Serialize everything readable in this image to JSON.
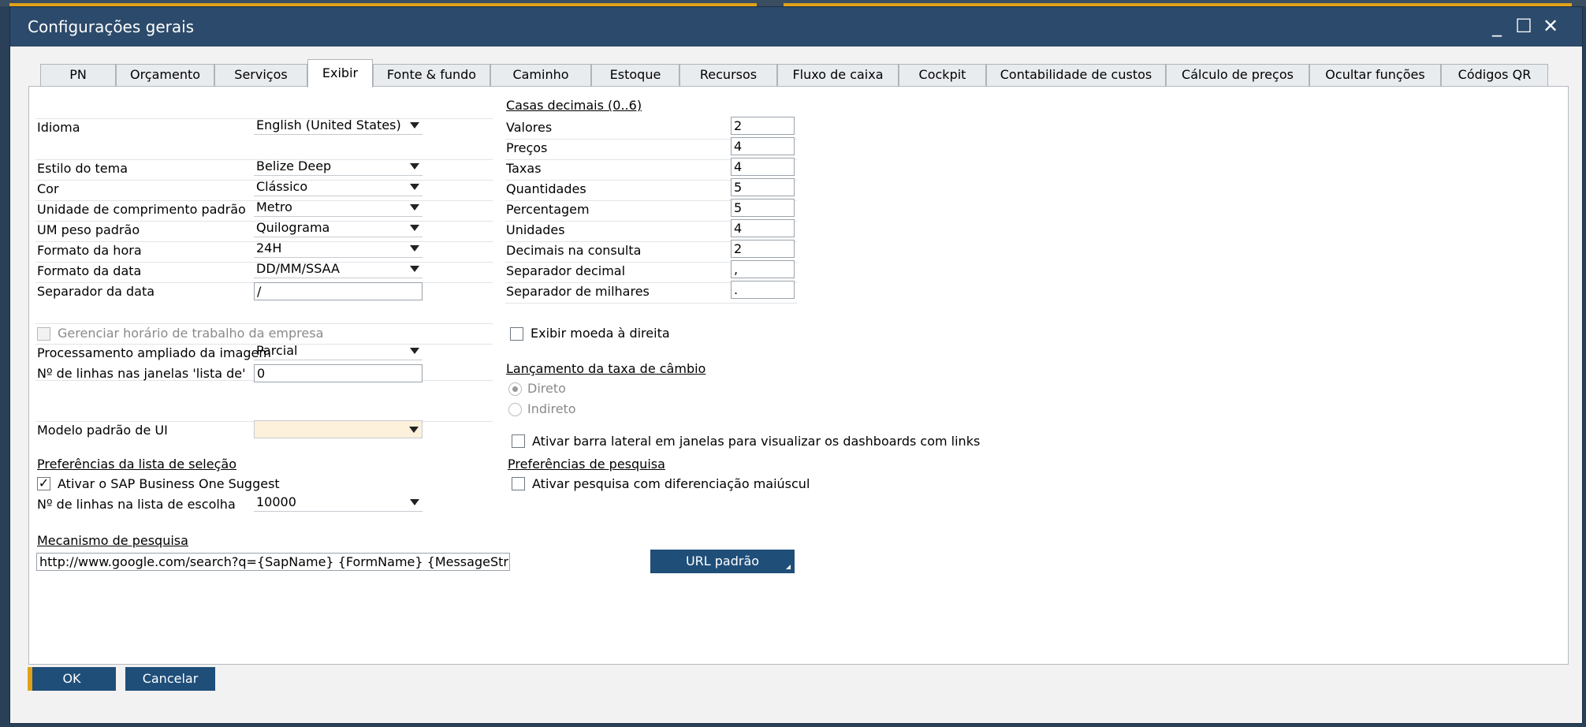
{
  "window": {
    "title": "Configurações gerais",
    "minimize_glyph": "_",
    "maximize_glyph": "☐",
    "close_glyph": "✕"
  },
  "tabs": [
    {
      "label": "PN",
      "active": false
    },
    {
      "label": "Orçamento",
      "active": false
    },
    {
      "label": "Serviços",
      "active": false
    },
    {
      "label": "Exibir",
      "active": true
    },
    {
      "label": "Fonte & fundo",
      "active": false
    },
    {
      "label": "Caminho",
      "active": false
    },
    {
      "label": "Estoque",
      "active": false
    },
    {
      "label": "Recursos",
      "active": false
    },
    {
      "label": "Fluxo de caixa",
      "active": false
    },
    {
      "label": "Cockpit",
      "active": false
    },
    {
      "label": "Contabilidade de custos",
      "active": false
    },
    {
      "label": "Cálculo de preços",
      "active": false
    },
    {
      "label": "Ocultar funções",
      "active": false
    },
    {
      "label": "Códigos QR",
      "active": false
    }
  ],
  "left": {
    "idioma": {
      "label": "Idioma",
      "value": "English (United States)"
    },
    "estilo_tema": {
      "label": "Estilo do tema",
      "value": "Belize Deep"
    },
    "cor": {
      "label": "Cor",
      "value": "Clássico"
    },
    "unidade_comprimento": {
      "label": "Unidade de comprimento padrão",
      "value": "Metro"
    },
    "um_peso": {
      "label": "UM peso padrão",
      "value": "Quilograma"
    },
    "formato_hora": {
      "label": "Formato da hora",
      "value": "24H"
    },
    "formato_data": {
      "label": "Formato da data",
      "value": "DD/MM/SSAA"
    },
    "separador_data": {
      "label": "Separador da data",
      "value": "/"
    },
    "gerenciar_horario": {
      "label": "Gerenciar horário de trabalho da empresa",
      "checked": false,
      "disabled": true
    },
    "processamento_imagem": {
      "label": "Processamento ampliado da imagem",
      "value": "Parcial"
    },
    "linhas_lista_de": {
      "label": "Nº de linhas nas janelas 'lista de'",
      "value": "0"
    },
    "modelo_ui": {
      "label": "Modelo padrão de UI",
      "value": ""
    },
    "preferencias_selecao": {
      "heading": "Preferências da lista de seleção"
    },
    "ativar_suggest": {
      "label": "Ativar o SAP Business One Suggest",
      "checked": true
    },
    "linhas_lista_escolha": {
      "label": "Nº de linhas na lista de escolha",
      "value": "10000"
    },
    "mecanismo": {
      "heading": "Mecanismo de pesquisa",
      "value": "http://www.google.com/search?q={SapName} {FormName} {MessageString} site:sap.com"
    },
    "url_padrao": "URL padrão"
  },
  "right": {
    "casas_heading": "Casas decimais (0..6)",
    "decimais": [
      {
        "label": "Valores",
        "value": "2"
      },
      {
        "label": "Preços",
        "value": "4"
      },
      {
        "label": "Taxas",
        "value": "4"
      },
      {
        "label": "Quantidades",
        "value": "5"
      },
      {
        "label": "Percentagem",
        "value": "5"
      },
      {
        "label": "Unidades",
        "value": "4"
      },
      {
        "label": "Decimais na consulta",
        "value": "2"
      },
      {
        "label": "Separador decimal",
        "value": ","
      },
      {
        "label": "Separador de milhares",
        "value": "."
      }
    ],
    "exibir_moeda": {
      "label": "Exibir moeda à direita",
      "checked": false
    },
    "lancamento_heading": "Lançamento da taxa de câmbio",
    "direto": {
      "label": "Direto",
      "selected": true,
      "disabled": true
    },
    "indireto": {
      "label": "Indireto",
      "selected": false,
      "disabled": true
    },
    "barra_lateral": {
      "label": "Ativar barra lateral em janelas para visualizar os dashboards com links",
      "checked": false
    },
    "pref_pesquisa_heading": "Preferências de pesquisa",
    "diferenciacao": {
      "label": "Ativar pesquisa com diferenciação maiúscul",
      "checked": false
    }
  },
  "footer": {
    "ok": "OK",
    "cancel": "Cancelar"
  },
  "colors": {
    "titlebar": "#2c4a6b",
    "accent": "#e0a21a",
    "button": "#1f4e79",
    "desktop": "#2a4058"
  }
}
